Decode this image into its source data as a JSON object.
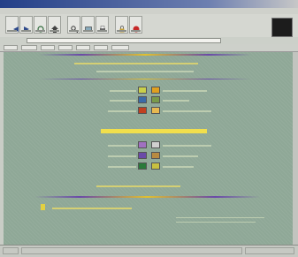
{
  "window": {
    "title": ""
  },
  "toolbar": {
    "buttons": [
      {
        "icon": "back-arrow-icon"
      },
      {
        "icon": "forward-arrow-icon"
      },
      {
        "icon": "reload-icon"
      },
      {
        "icon": "home-icon"
      },
      {
        "icon": "search-icon"
      },
      {
        "icon": "images-icon"
      },
      {
        "icon": "print-icon"
      },
      {
        "icon": "security-icon"
      },
      {
        "icon": "stop-icon"
      }
    ]
  },
  "content": {
    "thumbs_top": [
      {
        "icon": "photo-thumb-icon",
        "color": "#c9d04a"
      },
      {
        "icon": "photo-thumb-icon",
        "color": "#e0a020"
      },
      {
        "icon": "photo-thumb-icon",
        "color": "#3a6aa8"
      },
      {
        "icon": "photo-thumb-icon",
        "color": "#7a9a4a"
      },
      {
        "icon": "photo-thumb-icon",
        "color": "#c04020"
      },
      {
        "icon": "photo-thumb-icon",
        "color": "#e8b850"
      }
    ],
    "thumbs_bottom": [
      {
        "icon": "photo-thumb-icon",
        "color": "#a070c0"
      },
      {
        "icon": "photo-thumb-icon",
        "color": "#d0d0d0"
      },
      {
        "icon": "photo-thumb-icon",
        "color": "#6a4aa8"
      },
      {
        "icon": "photo-thumb-icon",
        "color": "#b88a40"
      },
      {
        "icon": "photo-thumb-icon",
        "color": "#2a7a3a"
      },
      {
        "icon": "photo-thumb-icon",
        "color": "#c8c040"
      }
    ]
  },
  "colors": {
    "page_bg": "#8fa897",
    "heading": "#f1df4c",
    "rule_purple": "#6a4aa8"
  }
}
